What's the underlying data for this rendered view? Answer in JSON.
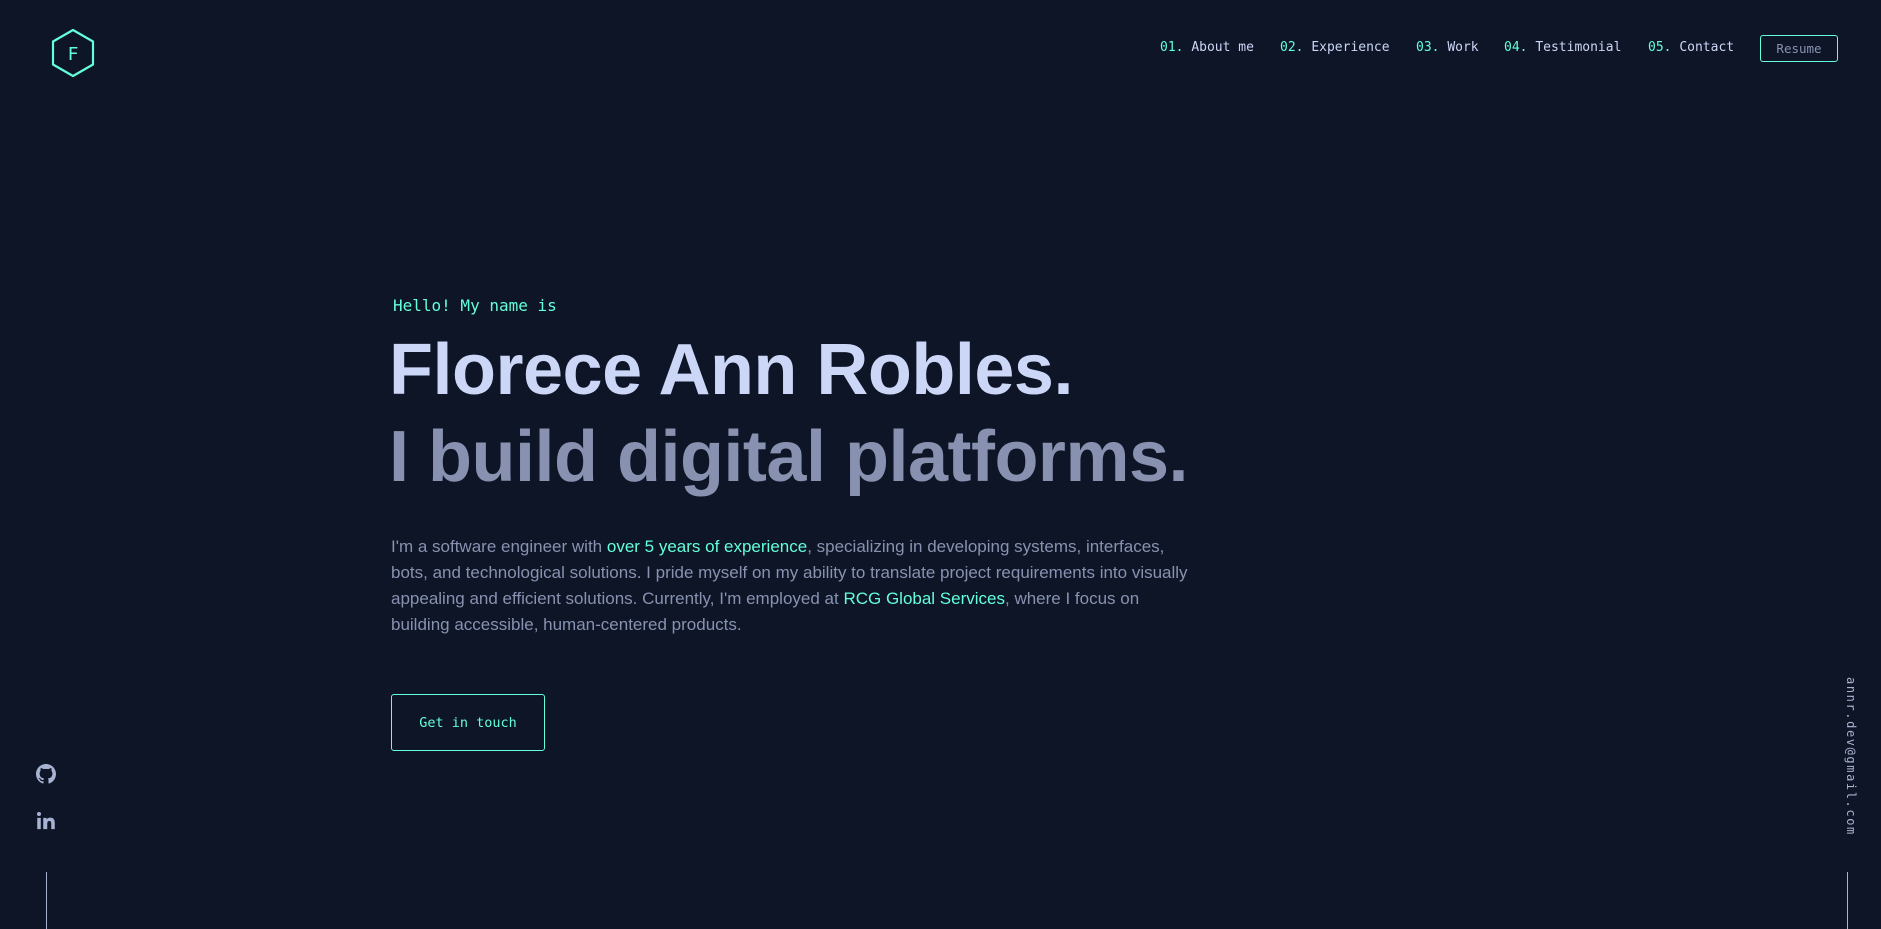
{
  "logo": {
    "letter": "F",
    "icon": "hexagon-logo-icon",
    "color": "#64ffda"
  },
  "nav": {
    "items": [
      {
        "num": "01.",
        "label": "About me"
      },
      {
        "num": "02.",
        "label": "Experience"
      },
      {
        "num": "03.",
        "label": "Work"
      },
      {
        "num": "04.",
        "label": "Testimonial"
      },
      {
        "num": "05.",
        "label": "Contact"
      }
    ],
    "resume_label": "Resume"
  },
  "hero": {
    "greeting": "Hello! My name is",
    "name": "Florece Ann Robles.",
    "tagline": "I build digital platforms.",
    "desc_part1": "I'm a software engineer with ",
    "desc_highlight1": "over 5 years of experience",
    "desc_part2": ", specializing in developing systems, interfaces, bots, and technological solutions. I pride myself on my ability to translate project requirements into visually appealing and efficient solutions. Currently, I'm employed at ",
    "desc_highlight2": "RCG Global Services",
    "desc_part3": ", where I focus on building accessible, human-centered products.",
    "cta_label": "Get in touch"
  },
  "social": {
    "icons": [
      "github-icon",
      "linkedin-icon"
    ]
  },
  "contact": {
    "email": "annr.dev@gmail.com"
  },
  "colors": {
    "background": "#0d1527",
    "accent": "#64ffda",
    "heading": "#ccd6f6",
    "text": "#8892b0"
  }
}
